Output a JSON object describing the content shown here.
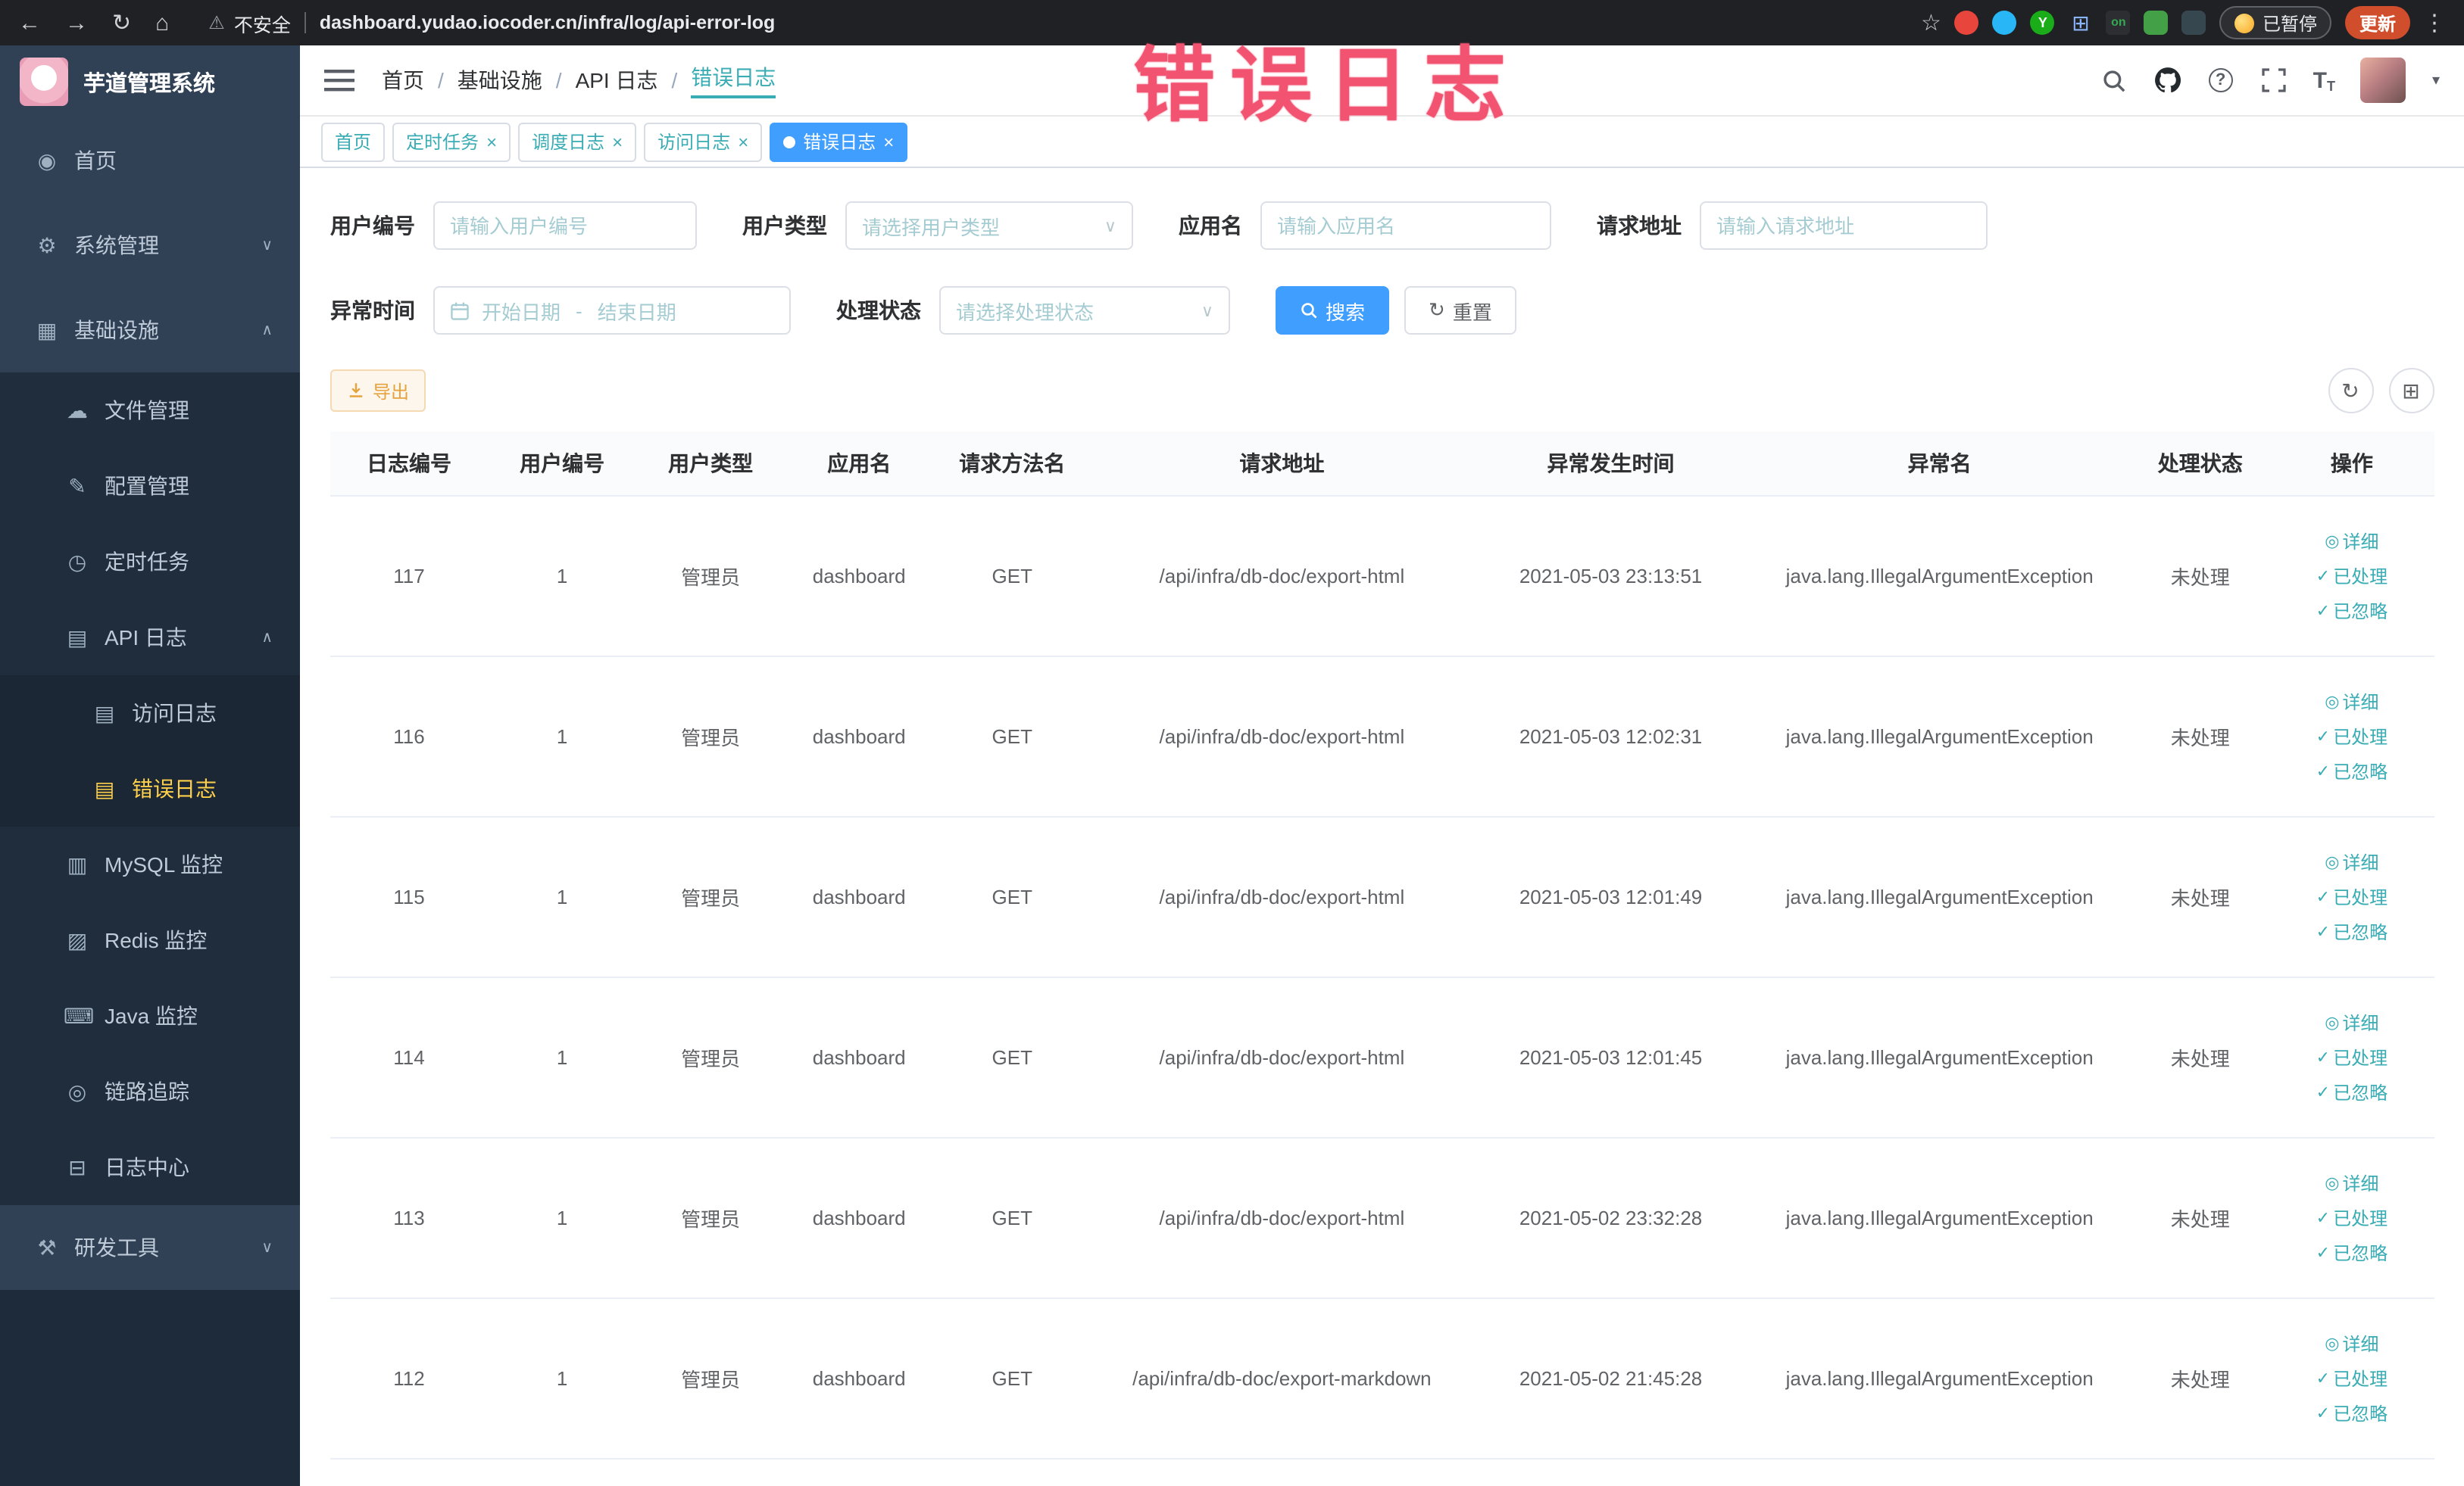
{
  "colors": {
    "accent_blue": "#409eff",
    "accent_teal": "#3aacb4",
    "sidebar_active": "#ffd04b",
    "annotation_pink": "#f25371",
    "warning_orange": "#e6a23c",
    "update_chip": "#d14e2c"
  },
  "icons": {
    "back": "←",
    "forward": "→",
    "reload": "↻",
    "home": "⌂",
    "warning": "⚠",
    "star": "☆",
    "kebab": "⋮",
    "help": "?",
    "caret_down": "▾",
    "select_caret": "∨",
    "refresh_circle": "↻",
    "columns_grid": "⊞",
    "fontsize_big": "T",
    "fontsize_small": "T"
  },
  "browser": {
    "security_label": "不安全",
    "url": "dashboard.yudao.iocoder.cn/infra/log/api-error-log",
    "extension_y": "Y",
    "extension_badge_on": "on",
    "paused_label": "已暂停",
    "update_label": "更新"
  },
  "annotation": {
    "text": "错误日志"
  },
  "sidebar": {
    "logo_title": "芋道管理系统",
    "items": [
      {
        "label": "首页",
        "icon": "◉"
      },
      {
        "label": "系统管理",
        "icon": "⚙",
        "chevron": "∨"
      },
      {
        "label": "基础设施",
        "icon": "▦",
        "chevron": "∧"
      },
      {
        "label": "文件管理",
        "icon": "☁"
      },
      {
        "label": "配置管理",
        "icon": "✎"
      },
      {
        "label": "定时任务",
        "icon": "◷"
      },
      {
        "label": "API 日志",
        "icon": "▤",
        "chevron": "∧"
      },
      {
        "label": "访问日志",
        "icon": "▤"
      },
      {
        "label": "错误日志",
        "icon": "▤"
      },
      {
        "label": "MySQL 监控",
        "icon": "▥"
      },
      {
        "label": "Redis 监控",
        "icon": "▨"
      },
      {
        "label": "Java 监控",
        "icon": "⌨"
      },
      {
        "label": "链路追踪",
        "icon": "◎"
      },
      {
        "label": "日志中心",
        "icon": "⊟"
      },
      {
        "label": "研发工具",
        "icon": "⚒",
        "chevron": "∨"
      }
    ]
  },
  "header": {
    "breadcrumb": [
      "首页",
      "基础设施",
      "API 日志",
      "错误日志"
    ]
  },
  "tabs": {
    "close_glyph": "×",
    "items": [
      {
        "label": "首页"
      },
      {
        "label": "定时任务"
      },
      {
        "label": "调度日志"
      },
      {
        "label": "访问日志"
      },
      {
        "label": "错误日志"
      }
    ]
  },
  "filters": {
    "user_id": {
      "label": "用户编号",
      "placeholder": "请输入用户编号"
    },
    "user_type": {
      "label": "用户类型",
      "placeholder": "请选择用户类型"
    },
    "app_name": {
      "label": "应用名",
      "placeholder": "请输入应用名"
    },
    "request_url": {
      "label": "请求地址",
      "placeholder": "请输入请求地址"
    },
    "exception_time": {
      "label": "异常时间",
      "start_placeholder": "开始日期",
      "separator": "-",
      "end_placeholder": "结束日期"
    },
    "process_status": {
      "label": "处理状态",
      "placeholder": "请选择处理状态"
    },
    "search_label": "搜索",
    "reset_label": "重置"
  },
  "toolbar": {
    "export_label": "导出"
  },
  "table": {
    "columns": [
      "日志编号",
      "用户编号",
      "用户类型",
      "应用名",
      "请求方法名",
      "请求地址",
      "异常发生时间",
      "异常名",
      "处理状态",
      "操作"
    ],
    "action_icons": [
      "◎",
      "✓",
      "✓"
    ],
    "actions": [
      "详细",
      "已处理",
      "已忽略"
    ],
    "rows": [
      {
        "id": "117",
        "user_id": "1",
        "user_type": "管理员",
        "app": "dashboard",
        "method": "GET",
        "url": "/api/infra/db-doc/export-html",
        "time": "2021-05-03 23:13:51",
        "exception": "java.lang.IllegalArgumentException",
        "status": "未处理"
      },
      {
        "id": "116",
        "user_id": "1",
        "user_type": "管理员",
        "app": "dashboard",
        "method": "GET",
        "url": "/api/infra/db-doc/export-html",
        "time": "2021-05-03 12:02:31",
        "exception": "java.lang.IllegalArgumentException",
        "status": "未处理"
      },
      {
        "id": "115",
        "user_id": "1",
        "user_type": "管理员",
        "app": "dashboard",
        "method": "GET",
        "url": "/api/infra/db-doc/export-html",
        "time": "2021-05-03 12:01:49",
        "exception": "java.lang.IllegalArgumentException",
        "status": "未处理"
      },
      {
        "id": "114",
        "user_id": "1",
        "user_type": "管理员",
        "app": "dashboard",
        "method": "GET",
        "url": "/api/infra/db-doc/export-html",
        "time": "2021-05-03 12:01:45",
        "exception": "java.lang.IllegalArgumentException",
        "status": "未处理"
      },
      {
        "id": "113",
        "user_id": "1",
        "user_type": "管理员",
        "app": "dashboard",
        "method": "GET",
        "url": "/api/infra/db-doc/export-html",
        "time": "2021-05-02 23:32:28",
        "exception": "java.lang.IllegalArgumentException",
        "status": "未处理"
      },
      {
        "id": "112",
        "user_id": "1",
        "user_type": "管理员",
        "app": "dashboard",
        "method": "GET",
        "url": "/api/infra/db-doc/export-markdown",
        "time": "2021-05-02 21:45:28",
        "exception": "java.lang.IllegalArgumentException",
        "status": "未处理"
      }
    ]
  }
}
